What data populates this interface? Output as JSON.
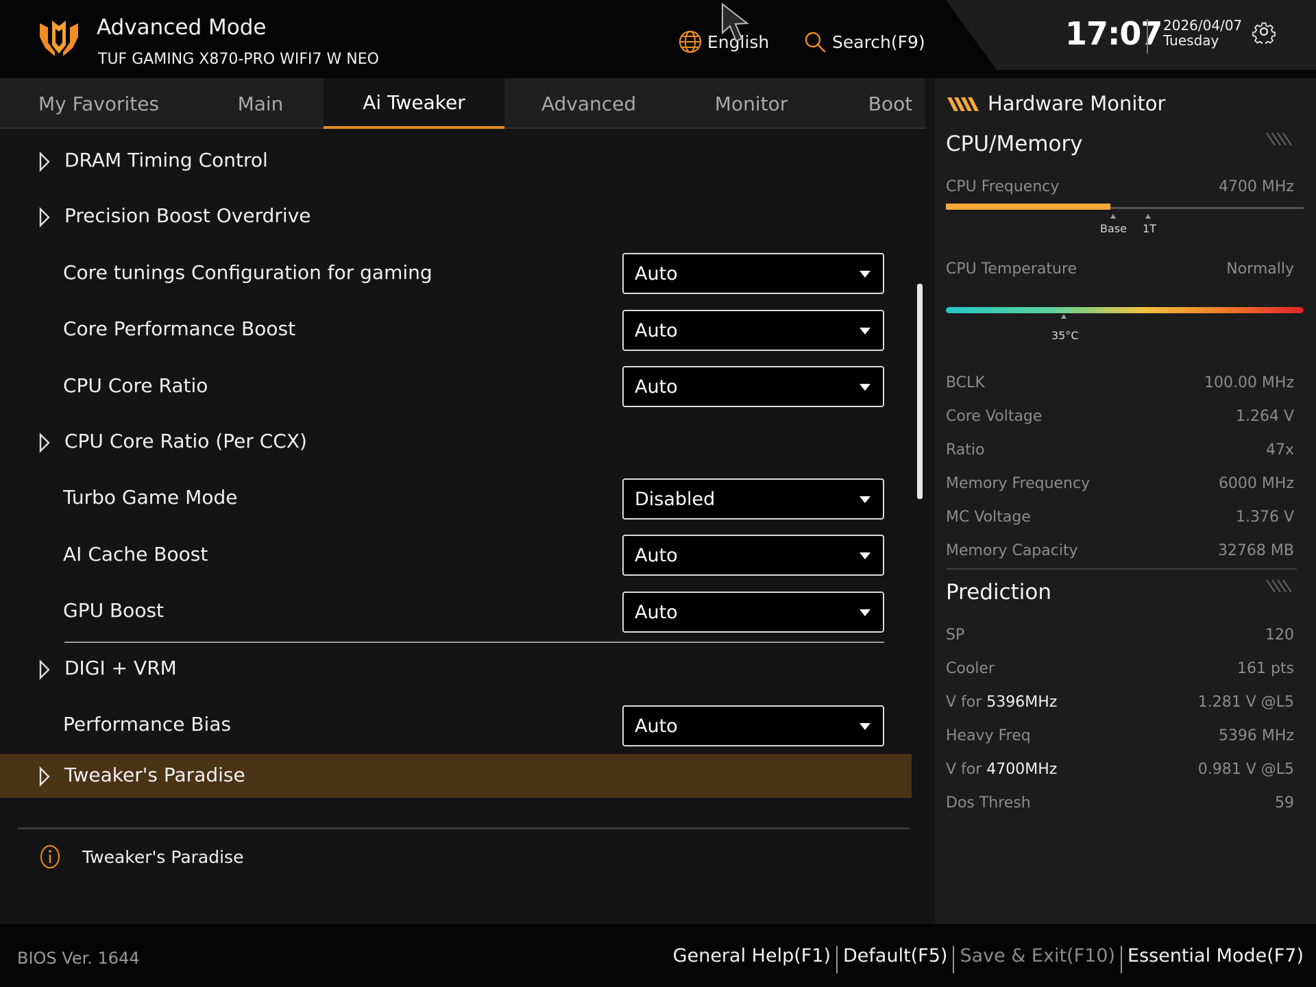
{
  "header": {
    "mode_title": "Advanced Mode",
    "board_name": "TUF GAMING X870-PRO WIFI7 W NEO",
    "language_label": "English",
    "search_label": "Search(F9)",
    "time": "17:07",
    "date": "2026/04/07",
    "weekday": "Tuesday"
  },
  "tabs": [
    {
      "label": "My Favorites"
    },
    {
      "label": "Main"
    },
    {
      "label": "Ai Tweaker"
    },
    {
      "label": "Advanced"
    },
    {
      "label": "Monitor"
    },
    {
      "label": "Boot"
    }
  ],
  "active_tab": "Ai Tweaker",
  "settings": [
    {
      "label": "DRAM Timing Control",
      "type": "submenu"
    },
    {
      "label": "Precision Boost Overdrive",
      "type": "submenu"
    },
    {
      "label": "Core tunings Configuration for gaming",
      "type": "select",
      "value": "Auto"
    },
    {
      "label": "Core Performance Boost",
      "type": "select",
      "value": "Auto"
    },
    {
      "label": "CPU Core Ratio",
      "type": "select",
      "value": "Auto"
    },
    {
      "label": "CPU Core Ratio (Per CCX)",
      "type": "submenu"
    },
    {
      "label": "Turbo Game Mode",
      "type": "select",
      "value": "Disabled"
    },
    {
      "label": "AI Cache Boost",
      "type": "select",
      "value": "Auto"
    },
    {
      "label": "GPU Boost",
      "type": "select",
      "value": "Auto"
    },
    {
      "label": "DIGI + VRM",
      "type": "submenu"
    },
    {
      "label": "Performance Bias",
      "type": "select",
      "value": "Auto"
    },
    {
      "label": "Tweaker's Paradise",
      "type": "submenu",
      "selected": true
    }
  ],
  "help": {
    "text": "Tweaker's Paradise"
  },
  "hardware_monitor": {
    "title": "Hardware Monitor",
    "cpu_memory": {
      "title": "CPU/Memory",
      "cpu_frequency": {
        "label": "CPU Frequency",
        "value": "4700 MHz",
        "fill_fraction": 0.46,
        "base_label": "Base",
        "onet_label": "1T"
      },
      "cpu_temperature": {
        "label": "CPU Temperature",
        "status": "Normally",
        "marker_label": "35°C"
      },
      "rows": [
        {
          "label": "BCLK",
          "value": "100.00 MHz"
        },
        {
          "label": "Core Voltage",
          "value": "1.264 V"
        },
        {
          "label": "Ratio",
          "value": "47x"
        },
        {
          "label": "Memory Frequency",
          "value": "6000 MHz"
        },
        {
          "label": "MC Voltage",
          "value": "1.376 V"
        },
        {
          "label": "Memory Capacity",
          "value": "32768 MB"
        }
      ]
    },
    "prediction": {
      "title": "Prediction",
      "rows": [
        {
          "label": "SP",
          "value": "120"
        },
        {
          "label": "Cooler",
          "value": "161 pts"
        },
        {
          "label_prefix": "V for ",
          "label_strong": "5396MHz",
          "value": "1.281 V @L5"
        },
        {
          "label": "Heavy Freq",
          "value": "5396 MHz"
        },
        {
          "label_prefix": "V for ",
          "label_strong": "4700MHz",
          "value": "0.981 V @L5"
        },
        {
          "label": "Dos Thresh",
          "value": "59"
        }
      ]
    }
  },
  "footer": {
    "bios_version": "BIOS Ver. 1644",
    "buttons": [
      {
        "label": "General Help(F1)",
        "dim": false
      },
      {
        "label": "Default(F5)",
        "dim": false
      },
      {
        "label": "Save & Exit(F10)",
        "dim": true
      },
      {
        "label": "Essential Mode(F7)",
        "dim": false
      }
    ]
  },
  "colors": {
    "accent": "#e38a26",
    "selected_row": "#4b3316",
    "freq_fill": "#f4a93c"
  },
  "icons": [
    "tuf-logo-icon",
    "globe-icon",
    "search-icon",
    "gear-icon",
    "expand-caret-icon",
    "dropdown-arrow-icon",
    "info-icon",
    "hardware-monitor-stripes-icon",
    "mouse-cursor-icon"
  ]
}
